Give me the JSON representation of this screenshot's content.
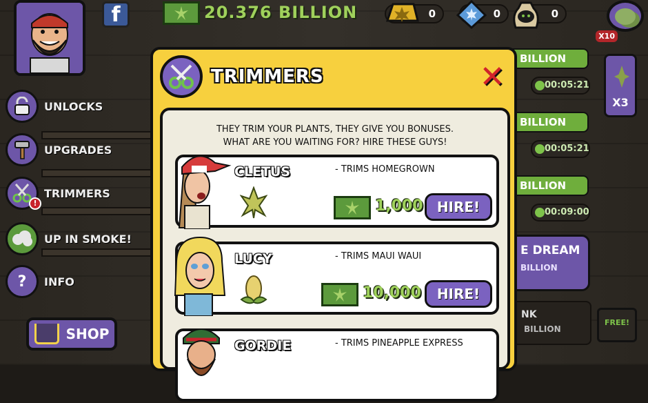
{
  "header": {
    "money": "20.376 BILLION",
    "currencies": [
      {
        "icon": "gold-bar-icon",
        "value": "0"
      },
      {
        "icon": "blue-gem-icon",
        "value": "0"
      },
      {
        "icon": "seed-bag-icon",
        "value": "0"
      }
    ],
    "multiplier_badge": "X10"
  },
  "menu": {
    "items": [
      {
        "label": "UNLOCKS",
        "icon": "lock-icon"
      },
      {
        "label": "UPGRADES",
        "icon": "hammer-icon"
      },
      {
        "label": "TRIMMERS",
        "icon": "scissors-icon",
        "badge": "!"
      },
      {
        "label": "UP IN SMOKE!",
        "icon": "smoke-cloud-icon"
      },
      {
        "label": "INFO",
        "icon": "question-icon"
      }
    ],
    "shop_label": "SHOP"
  },
  "right_panel": {
    "rows": [
      {
        "bar": "BILLION",
        "timer": "00:05:21"
      },
      {
        "bar": "BILLION",
        "timer": "00:05:21"
      },
      {
        "bar": "BILLION",
        "timer": "00:09:00"
      }
    ],
    "boost_label": "X3",
    "dream_title": "E DREAM",
    "dream_sub": "BILLION",
    "dark_title": "NK",
    "dark_sub": "BILLION",
    "free_label": "FREE!"
  },
  "modal": {
    "title": "TRIMMERS",
    "close": "✕",
    "description_line1": "THEY TRIM YOUR PLANTS, THEY GIVE YOU BONUSES.",
    "description_line2": "WHAT ARE YOU WAITING FOR? HIRE THESE GUYS!",
    "trimmers": [
      {
        "name": "CLETUS",
        "trims": "- TRIMS HOMEGROWN",
        "price": "1,000",
        "action": "HIRE!"
      },
      {
        "name": "LUCY",
        "trims": "- TRIMS MAUI WAUI",
        "price": "10,000",
        "action": "HIRE!"
      },
      {
        "name": "GORDIE",
        "trims": "- TRIMS PINEAPPLE EXPRESS",
        "price": "",
        "action": ""
      }
    ]
  },
  "colors": {
    "purple": "#6d56a8",
    "gold": "#f7d03e",
    "green": "#9fd15b",
    "red": "#d2232a"
  }
}
